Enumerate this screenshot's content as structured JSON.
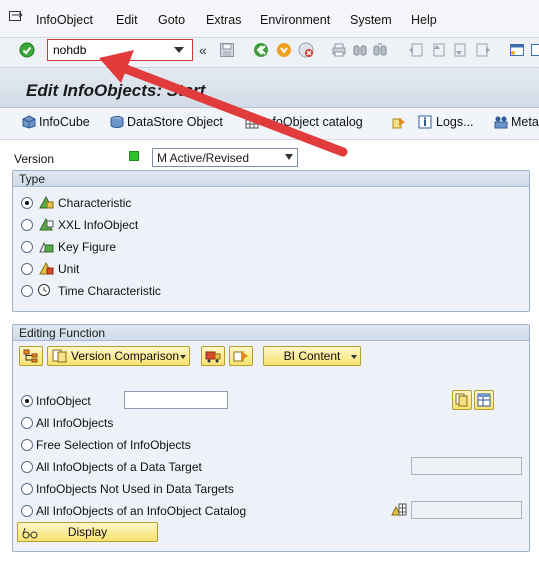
{
  "menu": {
    "items": [
      "InfoObject",
      "Edit",
      "Goto",
      "Extras",
      "Environment",
      "System",
      "Help"
    ]
  },
  "toolbar": {
    "command_value": "nohdb"
  },
  "title": "Edit InfoObjects: Start",
  "app_toolbar": {
    "infocube": "InfoCube",
    "datastore": "DataStore Object",
    "catalog": "InfoObject catalog",
    "logs": "Logs...",
    "metadata": "Meta"
  },
  "version": {
    "label": "Version",
    "value": "M Active/Revised",
    "status_color": "#2ec22e"
  },
  "type_group": {
    "title": "Type",
    "options": [
      "Characteristic",
      "XXL InfoObject",
      "Key Figure",
      "Unit",
      "Time Characteristic"
    ],
    "selected_index": 0
  },
  "editing_group": {
    "title": "Editing Function",
    "version_comparison": "Version Comparison",
    "bi_content": "BI Content",
    "options": [
      "InfoObject",
      "All InfoObjects",
      "Free Selection of InfoObjects",
      "All InfoObjects of a Data Target",
      "InfoObjects Not Used in Data Targets",
      "All InfoObjects of an InfoObject Catalog"
    ],
    "selected_index": 0,
    "display_button": "Display"
  },
  "colors": {
    "accent_red": "#e23b3b",
    "title_blue": "#d2dbe7",
    "button_yellow": "#f8e26f"
  }
}
